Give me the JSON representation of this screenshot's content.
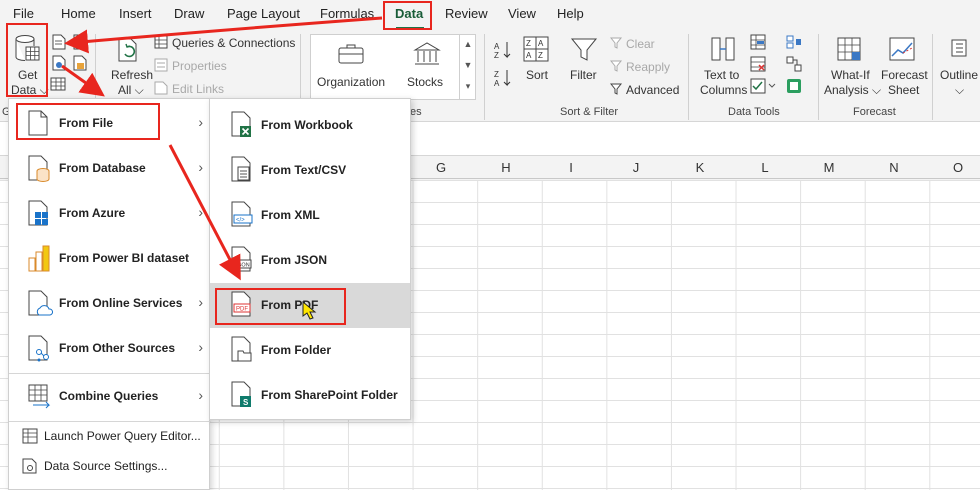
{
  "tabs": [
    "File",
    "Home",
    "Insert",
    "Draw",
    "Page Layout",
    "Formulas",
    "Data",
    "Review",
    "View",
    "Help"
  ],
  "ribbon": {
    "get_data": [
      "Get",
      "Data ⌵"
    ],
    "refresh": [
      "Refresh",
      "All ⌵"
    ],
    "queries_connections": "Queries & Connections",
    "properties": "Properties",
    "edit_links": "Edit Links",
    "organization": "Organization",
    "stocks": "Stocks",
    "sort": "Sort",
    "filter": "Filter",
    "clear": "Clear",
    "reapply": "Reapply",
    "advanced": "Advanced",
    "text_to_columns": [
      "Text to",
      "Columns"
    ],
    "whatif": [
      "What-If",
      "Analysis ⌵"
    ],
    "forecast_sheet": [
      "Forecast",
      "Sheet"
    ],
    "outline": [
      "Outline",
      "⌵"
    ],
    "group_sort_filter": "Sort & Filter",
    "group_data_tools": "Data Tools",
    "group_forecast": "Forecast",
    "group_partial_left": "G",
    "group_partial_types": "es"
  },
  "columns": [
    "G",
    "H",
    "I",
    "J",
    "K",
    "L",
    "M",
    "N",
    "O"
  ],
  "menu1": {
    "items": [
      "From File",
      "From Database",
      "From Azure",
      "From Power BI dataset",
      "From Online Services",
      "From Other Sources",
      "Combine Queries"
    ],
    "small_items": [
      "Launch Power Query Editor...",
      "Data Source Settings..."
    ]
  },
  "menu2": {
    "items": [
      "From Workbook",
      "From Text/CSV",
      "From XML",
      "From JSON",
      "From PDF",
      "From Folder",
      "From SharePoint Folder"
    ]
  },
  "colors": {
    "accent": "#217346",
    "annotation": "#e8261e",
    "highlight": "#d9d9d9"
  }
}
